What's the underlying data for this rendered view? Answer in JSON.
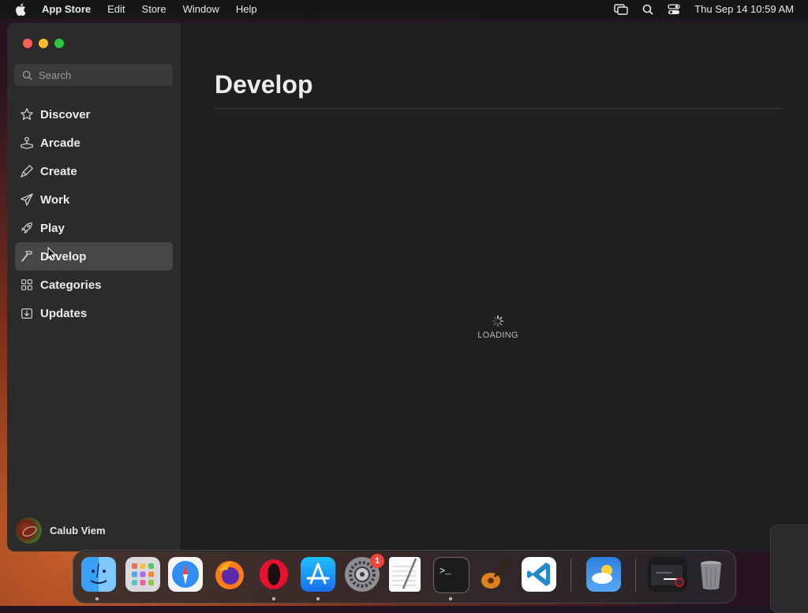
{
  "menubar": {
    "app_name": "App Store",
    "items": [
      "Edit",
      "Store",
      "Window",
      "Help"
    ],
    "clock": "Thu Sep 14  10:59 AM"
  },
  "sidebar": {
    "search_placeholder": "Search",
    "items": [
      {
        "label": "Discover",
        "icon": "star-icon"
      },
      {
        "label": "Arcade",
        "icon": "joystick-icon"
      },
      {
        "label": "Create",
        "icon": "brush-icon"
      },
      {
        "label": "Work",
        "icon": "paper-plane-icon"
      },
      {
        "label": "Play",
        "icon": "rocket-icon"
      },
      {
        "label": "Develop",
        "icon": "hammer-icon",
        "active": true
      },
      {
        "label": "Categories",
        "icon": "grid-icon"
      },
      {
        "label": "Updates",
        "icon": "download-icon"
      }
    ],
    "user_name": "Calub Viem"
  },
  "main": {
    "title": "Develop",
    "loading_text": "LOADING"
  },
  "dock": {
    "apps": [
      "Finder",
      "Launchpad",
      "Safari",
      "Firefox",
      "Opera",
      "App Store",
      "System Settings",
      "TextEdit",
      "Terminal",
      "GarageBand",
      "Visual Studio Code",
      "Weather",
      "Screenshot",
      "Trash"
    ],
    "settings_badge": "1"
  },
  "colors": {
    "close": "#ff5f57",
    "minimize": "#febc2e",
    "maximize": "#28c840",
    "sidebar_bg": "#2b2b2c",
    "main_bg": "#1f1f1f",
    "active_item": "#464647"
  }
}
